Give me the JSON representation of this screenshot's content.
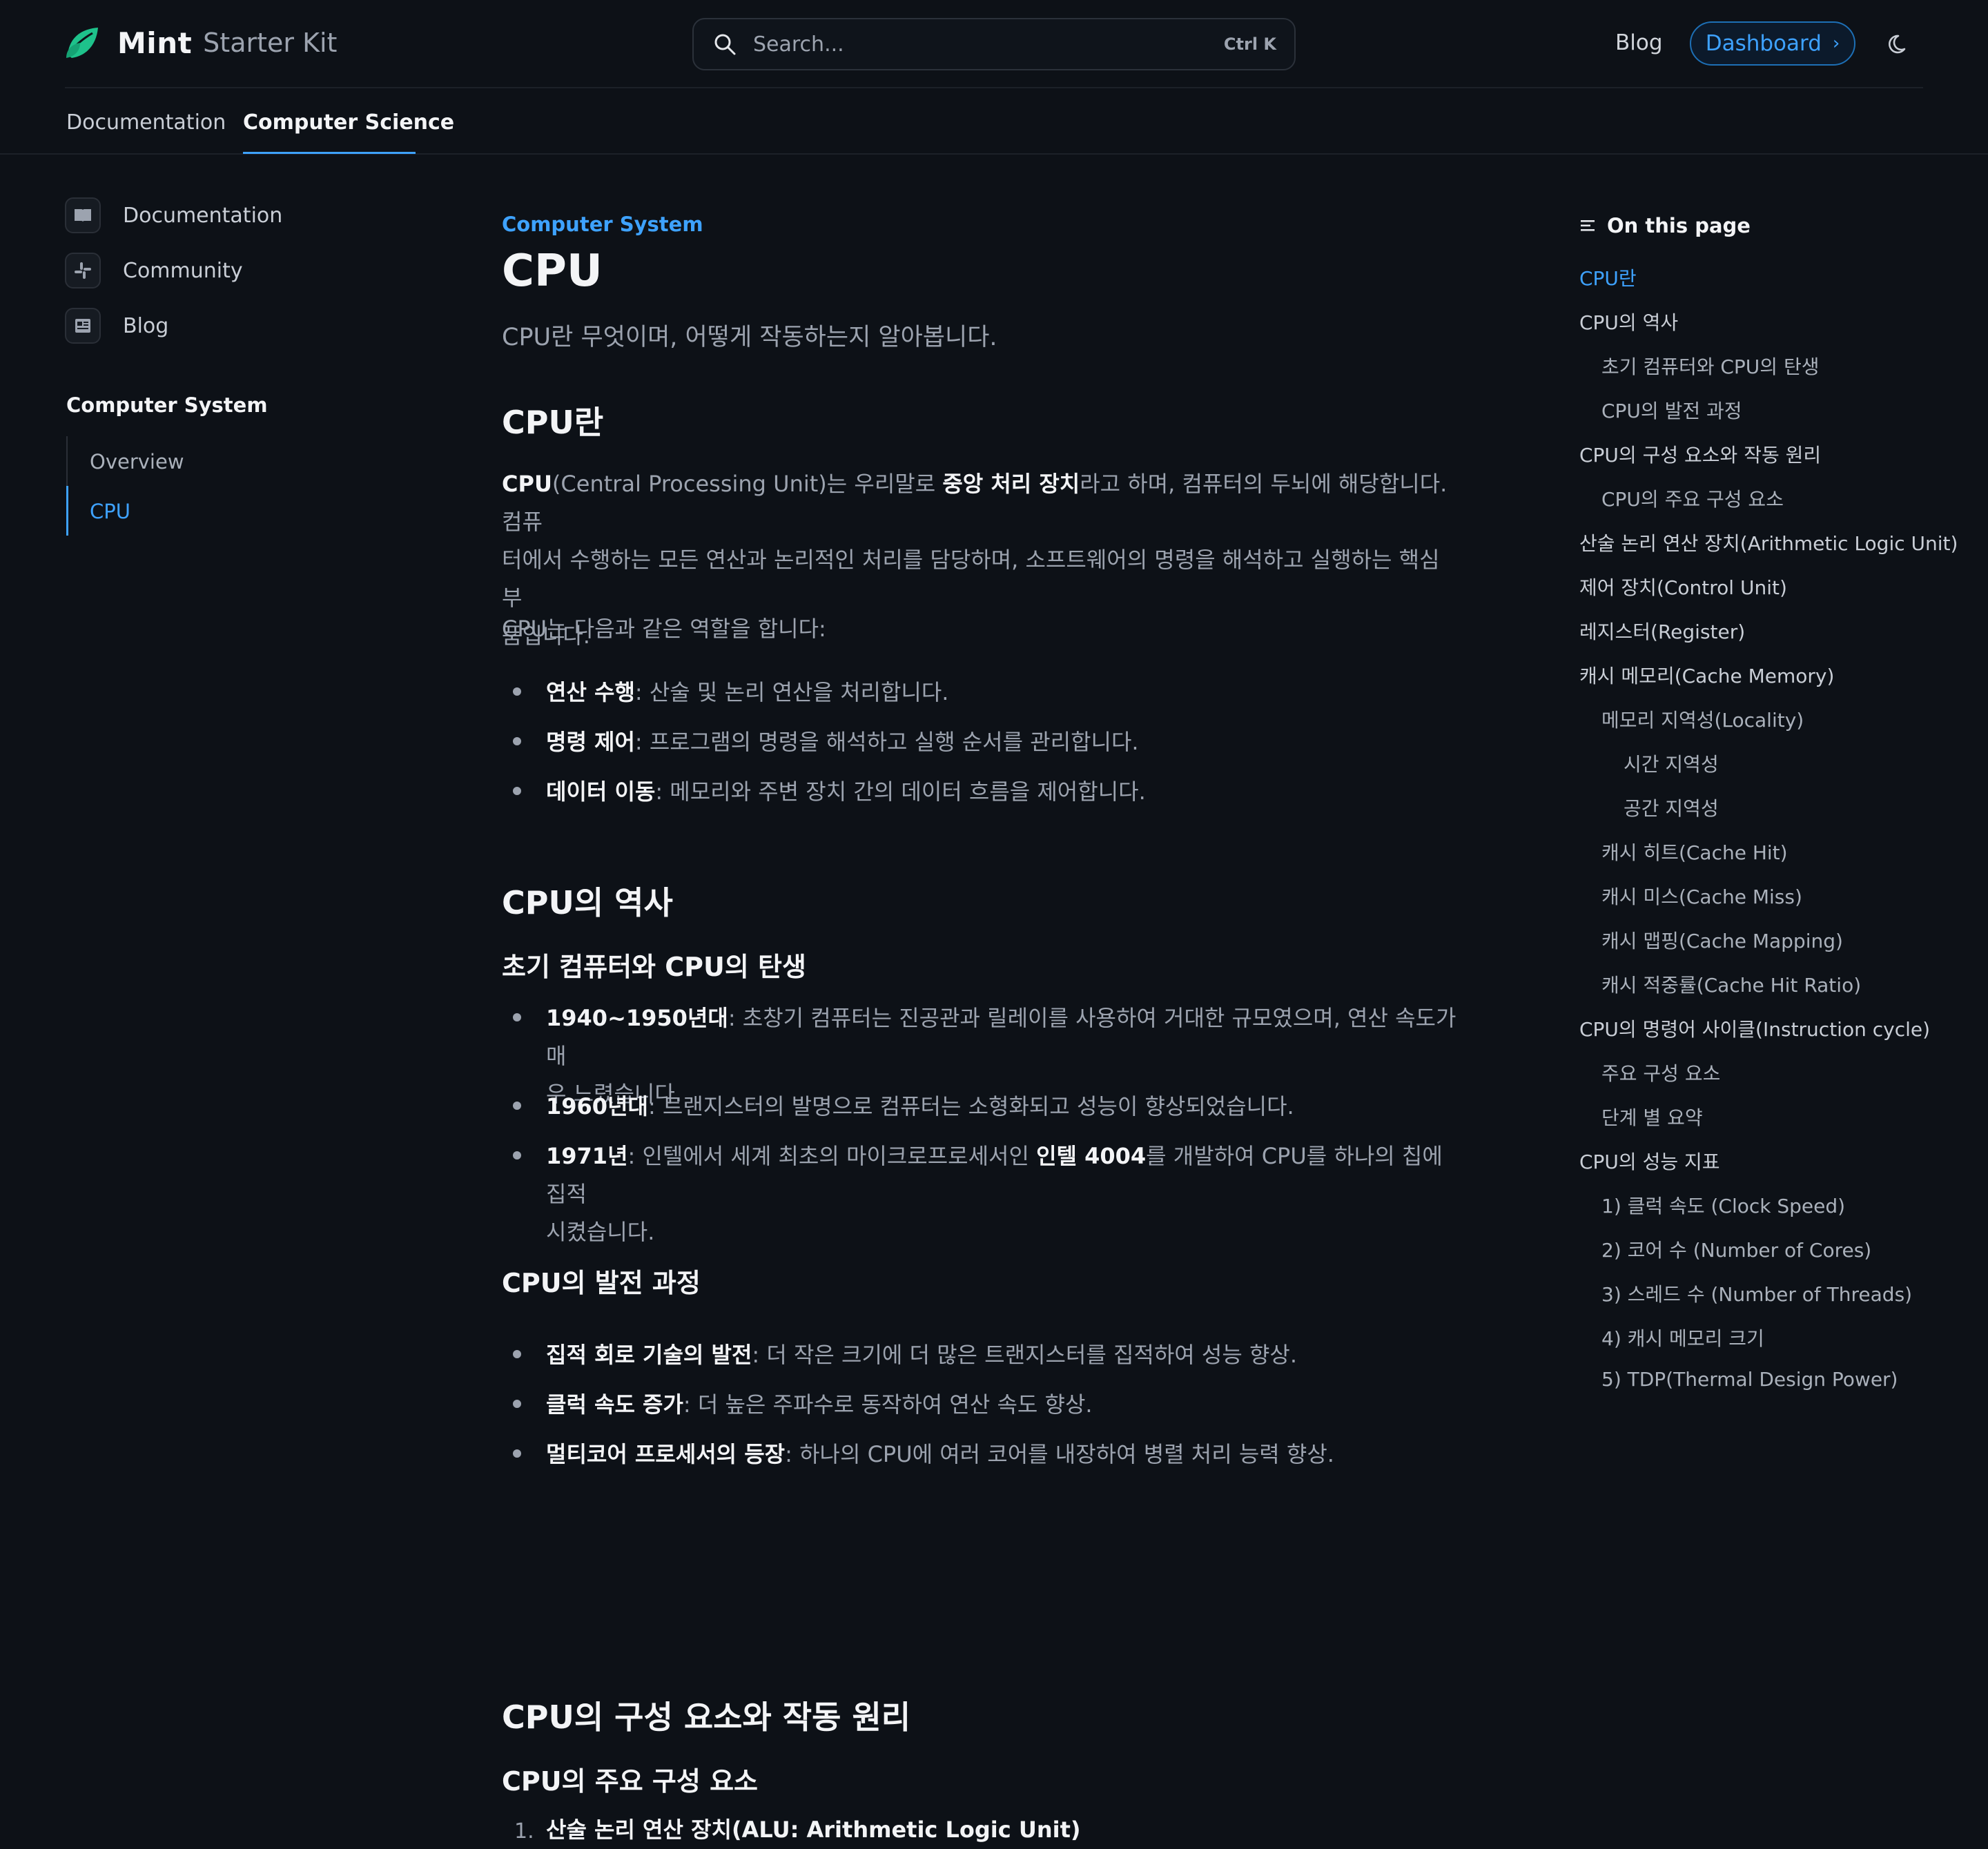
{
  "header": {
    "brand": "Mint",
    "brand_sub": "Starter Kit",
    "search_placeholder": "Search...",
    "search_shortcut": "Ctrl K",
    "blog_link": "Blog",
    "dashboard_button": "Dashboard",
    "accent_color": "#3ea2ff",
    "logo_color": "#1ec28b"
  },
  "tabs": [
    {
      "label": "Documentation",
      "active": false
    },
    {
      "label": "Computer Science",
      "active": true
    }
  ],
  "sidebar": {
    "links": [
      {
        "label": "Documentation",
        "icon": "book-icon"
      },
      {
        "label": "Community",
        "icon": "slack-icon"
      },
      {
        "label": "Blog",
        "icon": "newspaper-icon"
      }
    ],
    "group_title": "Computer System",
    "group_items": [
      {
        "label": "Overview",
        "active": false
      },
      {
        "label": "CPU",
        "active": true
      }
    ]
  },
  "main": {
    "eyebrow": "Computer System",
    "title": "CPU",
    "description": "CPU란 무엇이며, 어떻게 작동하는지 알아봅니다.",
    "s1_heading": "CPU란",
    "s1_p1": {
      "b1": "CPU",
      "t1": "(Central Processing Unit)는 우리말로 ",
      "b2": "중앙 처리 장치",
      "t2": "라고 하며, 컴퓨터의 두뇌에 해당합니다. 컴퓨",
      "line2": "터에서 수행하는 모든 연산과 논리적인 처리를 담당하며, 소프트웨어의 명령을 해석하고 실행하는 핵심 부",
      "line3": "품입니다."
    },
    "s1_p2": "CPU는 다음과 같은 역할을 합니다:",
    "s1_list": [
      {
        "bold": "연산 수행",
        "text": ": 산술 및 논리 연산을 처리합니다."
      },
      {
        "bold": "명령 제어",
        "text": ": 프로그램의 명령을 해석하고 실행 순서를 관리합니다."
      },
      {
        "bold": "데이터 이동",
        "text": ": 메모리와 주변 장치 간의 데이터 흐름을 제어합니다."
      }
    ],
    "s2_heading": "CPU의 역사",
    "s2_sub1": "초기 컴퓨터와 CPU의 탄생",
    "s2_list": [
      {
        "bold": "1940~1950년대",
        "text": ": 초창기 컴퓨터는 진공관과 릴레이를 사용하여 거대한 규모였으며, 연산 속도가 매",
        "line2": "우 느렸습니다."
      },
      {
        "bold": "1960년대",
        "text": ": 트랜지스터의 발명으로 컴퓨터는 소형화되고 성능이 향상되었습니다."
      },
      {
        "bold": "1971년",
        "text": ": 인텔에서 세계 최초의 마이크로프로세서인 ",
        "bold2": "인텔 4004",
        "text2": "를 개발하여 CPU를 하나의 칩에 집적",
        "line2": "시켰습니다."
      }
    ],
    "s2_sub2": "CPU의 발전 과정",
    "s2_list2": [
      {
        "bold": "집적 회로 기술의 발전",
        "text": ": 더 작은 크기에 더 많은 트랜지스터를 집적하여 성능 향상."
      },
      {
        "bold": "클럭 속도 증가",
        "text": ": 더 높은 주파수로 동작하여 연산 속도 향상."
      },
      {
        "bold": "멀티코어 프로세서의 등장",
        "text": ": 하나의 CPU에 여러 코어를 내장하여 병렬 처리 능력 향상."
      }
    ],
    "s3_heading": "CPU의 구성 요소와 작동 원리",
    "s3_sub1": "CPU의 주요 구성 요소",
    "s3_list_first": {
      "num": "1.",
      "bold": "산술 논리 연산 장치(ALU: Arithmetic Logic Unit)"
    }
  },
  "toc": {
    "title": "On this page",
    "items": [
      {
        "label": "CPU란",
        "level": 1,
        "active": true
      },
      {
        "label": "CPU의 역사",
        "level": 1
      },
      {
        "label": "초기 컴퓨터와 CPU의 탄생",
        "level": 2
      },
      {
        "label": "CPU의 발전 과정",
        "level": 2
      },
      {
        "label": "CPU의 구성 요소와 작동 원리",
        "level": 1
      },
      {
        "label": "CPU의 주요 구성 요소",
        "level": 2
      },
      {
        "label": "산술 논리 연산 장치(Arithmetic Logic Unit)",
        "level": 1
      },
      {
        "label": "제어 장치(Control Unit)",
        "level": 1
      },
      {
        "label": "레지스터(Register)",
        "level": 1
      },
      {
        "label": "캐시 메모리(Cache Memory)",
        "level": 1
      },
      {
        "label": "메모리 지역성(Locality)",
        "level": 2
      },
      {
        "label": "시간 지역성",
        "level": 3
      },
      {
        "label": "공간 지역성",
        "level": 3
      },
      {
        "label": "캐시 히트(Cache Hit)",
        "level": 2
      },
      {
        "label": "캐시 미스(Cache Miss)",
        "level": 2
      },
      {
        "label": "캐시 맵핑(Cache Mapping)",
        "level": 2
      },
      {
        "label": "캐시 적중률(Cache Hit Ratio)",
        "level": 2
      },
      {
        "label": "CPU의 명령어 사이클(Instruction cycle)",
        "level": 1
      },
      {
        "label": "주요 구성 요소",
        "level": 2
      },
      {
        "label": "단계 별 요약",
        "level": 2
      },
      {
        "label": "CPU의 성능 지표",
        "level": 1
      },
      {
        "label": "1) 클럭 속도 (Clock Speed)",
        "level": 2
      },
      {
        "label": "2) 코어 수 (Number of Cores)",
        "level": 2
      },
      {
        "label": "3) 스레드 수 (Number of Threads)",
        "level": 2
      },
      {
        "label": "4) 캐시 메모리 크기",
        "level": 2
      },
      {
        "label": "5) TDP(Thermal Design Power)",
        "level": 2
      }
    ]
  }
}
